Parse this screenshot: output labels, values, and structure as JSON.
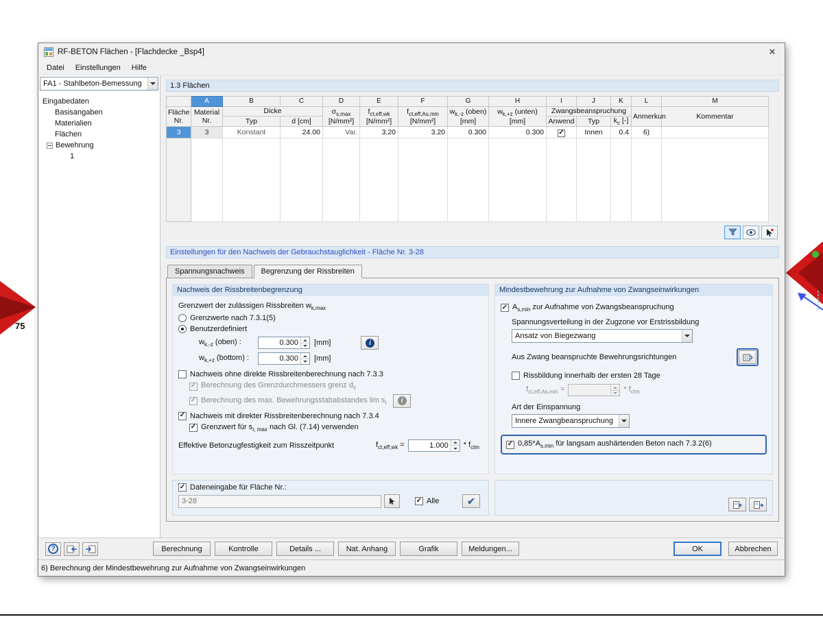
{
  "icons": {
    "close": "✕",
    "help": "?",
    "apply": "✔",
    "info": "i"
  },
  "colors": {
    "selection_blue": "#4f94d6",
    "highlight_border": "#2e62b0",
    "strip_blue": "#dce7f4",
    "accent_red": "#cf1a1a"
  },
  "background": {
    "label": "75"
  },
  "window": {
    "title": "RF-BETON Flächen - [Flachdecke _Bsp4]"
  },
  "menu": {
    "items": [
      "Datei",
      "Einstellungen",
      "Hilfe"
    ]
  },
  "sidebar": {
    "case_selector": "FA1 - Stahlbeton-Bemessung",
    "tree": {
      "root": "Eingabedaten",
      "basisangaben": "Basisangaben",
      "materialien": "Materialien",
      "flaechen": "Flächen",
      "bewehrung": "Bewehrung",
      "bewehrung_child": "1"
    }
  },
  "section": {
    "title": "1.3 Flächen"
  },
  "table": {
    "letters": [
      "A",
      "B",
      "C",
      "D",
      "E",
      "F",
      "G",
      "H",
      "I",
      "J",
      "K",
      "L",
      "M"
    ],
    "headers": {
      "flaeche_line1": "Fläche",
      "flaeche_line2": "Nr.",
      "material_line1": "Material",
      "material_line2": "Nr.",
      "dicke": "Dicke",
      "typ": "Typ",
      "d_cm": "d [cm]",
      "sigma_pre": "σ",
      "sigma_sub": "s,max",
      "nmm2": "[N/mm²]",
      "fctwk_pre": "f",
      "fctwk_sub": "ct,eff,wk",
      "fctas_pre": "f",
      "fctas_sub": "ct,eff,As,min",
      "wkminus_pre": "w",
      "wkminus_sub": "k,-z",
      "wkminus_post": " (oben)",
      "mm": "[mm]",
      "wkplus_pre": "w",
      "wkplus_sub": "k,+z",
      "wkplus_post": " (unten)",
      "zwang_group": "Zwangsbeanspruchung",
      "anwend": "Anwend",
      "zwang_typ": "Typ",
      "kc_pre": "k",
      "kc_sub": "c",
      "kc_post": " [-]",
      "anmerkung": "Anmerkun",
      "kommentar": "Kommentar"
    },
    "row": {
      "flaeche": "3",
      "material": "3",
      "typ": "Konstant",
      "d": "24.00",
      "sigma": "Var.",
      "fct_wk": "3.20",
      "fct_as": "3.20",
      "wk_minus": "0.300",
      "wk_plus": "0.300",
      "zwang_typ": "Innen",
      "kc": "0.4",
      "anmerkung": "6)",
      "kommentar": ""
    }
  },
  "settings": {
    "header": "Einstellungen für den Nachweis der Gebrauchstauglichkeit - Fläche Nr. 3-28",
    "tabs": [
      "Spannungsnachweis",
      "Begrenzung der Rissbreiten"
    ]
  },
  "crack_group": {
    "title": "Nachweis der Rissbreitenbegrenzung",
    "limit_label_pre": "Grenzwert der zulässigen Rissbreiten w",
    "limit_label_sub": "k,max",
    "radio_code": "Grenzwerte nach 7.3.1(5)",
    "radio_user": "Benutzerdefiniert",
    "wk_oben_pre": "w",
    "wk_oben_sub": "k,-z",
    "wk_oben_post": " (oben) :",
    "wk_oben_value": "0.300",
    "wk_bottom_pre": "w",
    "wk_bottom_sub": "k,+z",
    "wk_bottom_post": " (bottom) :",
    "wk_bottom_value": "0.300",
    "unit_mm": "[mm]",
    "cb_no_direct": "Nachweis ohne direkte Rissbreitenberechnung nach 7.3.3",
    "cb_grenz_pre": "Berechnung des Grenzdurchmessers  grenz d",
    "cb_grenz_sub": "s",
    "cb_lim_pre": "Berechnung des max. Bewehrungsstababstandes  lim s",
    "cb_lim_sub": "l",
    "cb_direct": "Nachweis mit direkter Rissbreitenberechnung nach 7.3.4",
    "cb_sr_pre": "Grenzwert für s",
    "cb_sr_sub": "r, max",
    "cb_sr_post": " nach Gl. (7.14) verwenden",
    "eff_label": "Effektive Betonzugfestigkeit zum Risszeitpunkt",
    "fct_pre": "f",
    "fct_sub": "ct,eff,wk",
    "fct_post": " =",
    "fct_value": "1.000",
    "fctm_pre": "* f",
    "fctm_sub": "ctm"
  },
  "min_reinf_group": {
    "title": "Mindestbewehrung zur Aufnahme von Zwangseinwirkungen",
    "cb_asmin_pre": "A",
    "cb_asmin_sub": "s,min",
    "cb_asmin_post": " zur Aufnahme von Zwangsbeanspruchung",
    "stress_label": "Spannungsverteilung in der Zugzone vor Erstrissbildung",
    "stress_value": "Ansatz von Biegezwang",
    "direction_label": "Aus Zwang beanspruchte Bewehrungsrichtungen",
    "cb_28days": "Rissbildung innerhalb der ersten 28 Tage",
    "fct_pre": "f",
    "fct_sub": "ct,eff,As,min",
    "fct_post": " =",
    "fct_value": "",
    "fctm_pre": "* f",
    "fctm_sub": "ctm",
    "restraint_label": "Art der Einspannung",
    "restraint_value": "Innere Zwangbeanspruchung",
    "cb_085_pre": "0,85*A",
    "cb_085_sub": "s,min",
    "cb_085_post": " für langsam aushärtenden Beton nach 7.3.2(6)"
  },
  "surface_panel": {
    "cb_label": "Dateneingabe für Fläche Nr.:",
    "input_value": "3-28",
    "cb_alle": "Alle"
  },
  "buttons": {
    "berechnung": "Berechnung",
    "kontrolle": "Kontrolle",
    "details": "Details ...",
    "nat_anhang": "Nat. Anhang",
    "grafik": "Grafik",
    "meldungen": "Meldungen...",
    "ok": "OK",
    "abbrechen": "Abbrechen"
  },
  "statusbar": {
    "text": "6) Berechnung der Mindestbewehrung zur Aufnahme von Zwangseinwirkungen"
  }
}
